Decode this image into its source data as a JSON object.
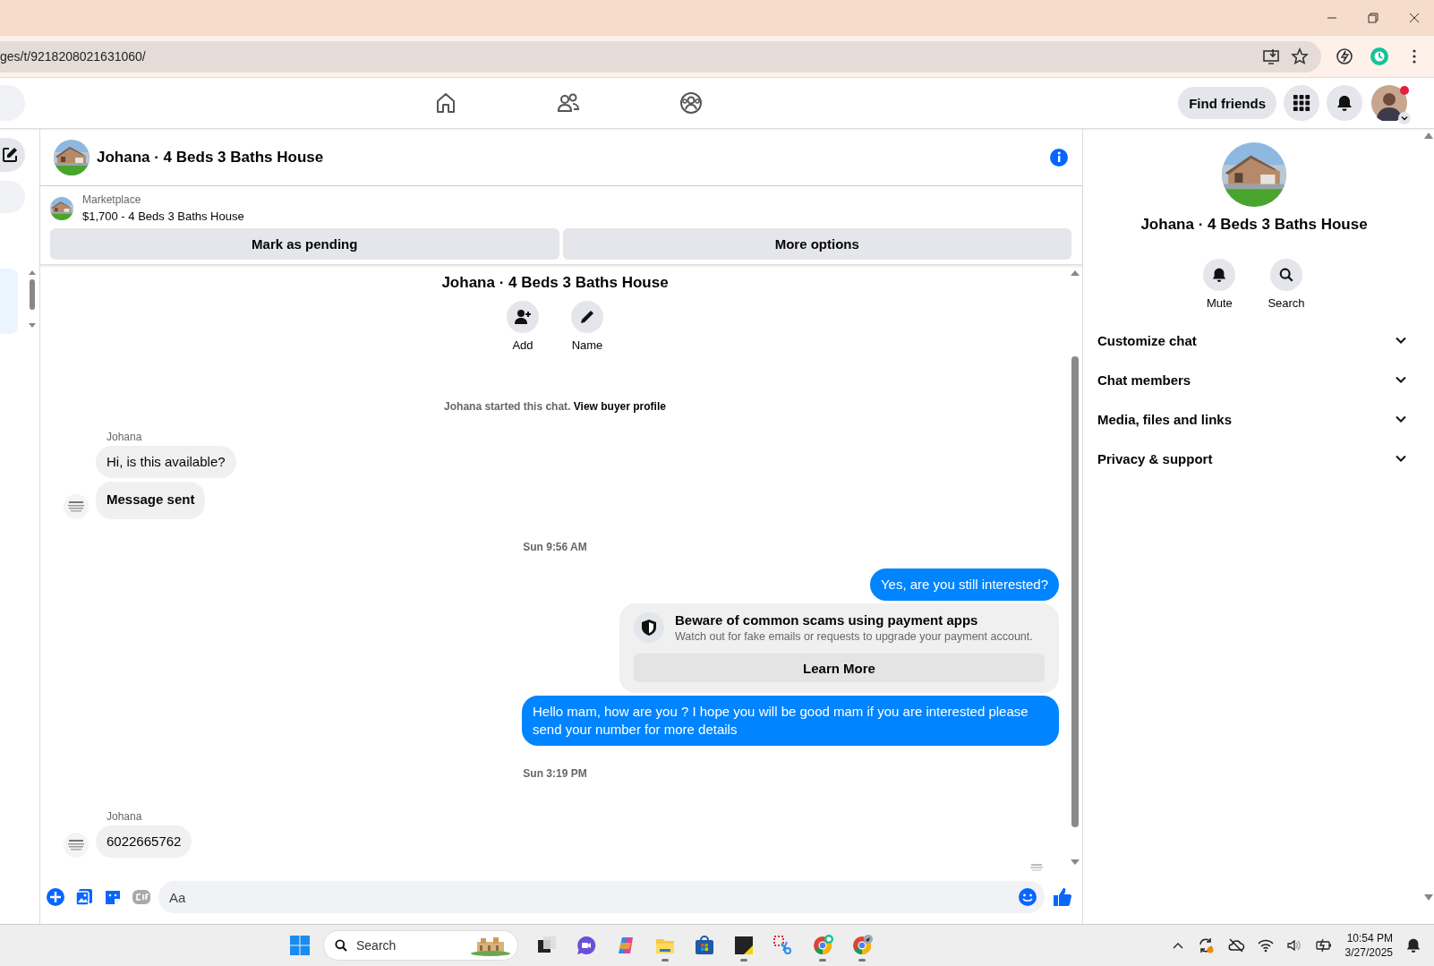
{
  "browser": {
    "url": "ges/t/9218208021631060/"
  },
  "nav": {
    "find_friends": "Find friends"
  },
  "chat": {
    "title": "Johana · 4 Beds 3 Baths House",
    "listing": {
      "source": "Marketplace",
      "summary": "$1,700 - 4 Beds 3 Baths House"
    },
    "actions": [
      "Mark as pending",
      "More options"
    ],
    "intro": {
      "title": "Johana · 4 Beds 3 Baths House",
      "buttons": [
        {
          "kind": "add",
          "label": "Add"
        },
        {
          "kind": "name",
          "label": "Name"
        }
      ],
      "notice": "Johana started this chat.",
      "notice_link": "View buyer profile"
    },
    "messages": [
      {
        "kind": "sender",
        "text": "Johana"
      },
      {
        "kind": "incoming",
        "text": "Hi, is this available?",
        "bold": false,
        "avatar": false
      },
      {
        "kind": "incoming",
        "text": "Message sent",
        "bold": true,
        "avatar": true
      },
      {
        "kind": "timestamp",
        "text": "Sun 9:56 AM"
      },
      {
        "kind": "outgoing",
        "text": "Yes, are you still interested?"
      },
      {
        "kind": "warning",
        "title": "Beware of common scams using payment apps",
        "text": "Watch out for fake emails or requests to upgrade your payment account.",
        "button": "Learn More"
      },
      {
        "kind": "outgoing",
        "text": "Hello mam, how are you ?  I hope you will be good mam if you are interested please send your number for more details"
      },
      {
        "kind": "timestamp",
        "text": "Sun 3:19 PM"
      },
      {
        "kind": "sender",
        "text": "Johana"
      },
      {
        "kind": "incoming",
        "text": "6022665762",
        "bold": false,
        "avatar": true
      }
    ],
    "composer": {
      "placeholder": "Aa"
    }
  },
  "right_panel": {
    "title": "Johana · 4 Beds 3 Baths House",
    "actions": [
      {
        "kind": "mute",
        "label": "Mute"
      },
      {
        "kind": "search",
        "label": "Search"
      }
    ],
    "sections": [
      {
        "label": "Customize chat",
        "expanded": false
      },
      {
        "label": "Chat members",
        "expanded": false
      },
      {
        "label": "Media, files and links",
        "expanded": false
      },
      {
        "label": "Privacy & support",
        "expanded": false
      }
    ]
  },
  "taskbar": {
    "search": {
      "placeholder": "Search"
    },
    "apps": [
      {
        "kind": "taskview",
        "running": false
      },
      {
        "kind": "meet",
        "running": false
      },
      {
        "kind": "copilot",
        "running": false
      },
      {
        "kind": "explorer",
        "running": true
      },
      {
        "kind": "store",
        "running": false
      },
      {
        "kind": "sticky",
        "running": true
      },
      {
        "kind": "snip",
        "running": false
      },
      {
        "kind": "chrome",
        "running": true
      },
      {
        "kind": "chrome2",
        "running": true
      }
    ],
    "time": "10:54 PM",
    "date": "3/27/2025"
  }
}
